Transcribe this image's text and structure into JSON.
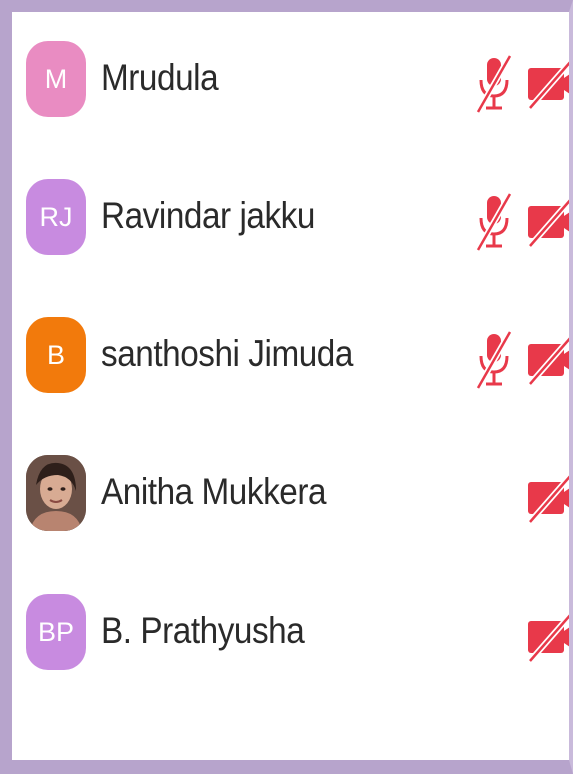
{
  "participants": [
    {
      "initials": "M",
      "name": "Mrudula",
      "avatar_color": "#e98cc2",
      "avatar_type": "initials",
      "mic": "muted-icon",
      "camera": "video-off-icon"
    },
    {
      "initials": "RJ",
      "name": "Ravindar jakku",
      "avatar_color": "#c88be0",
      "avatar_type": "initials",
      "mic": "muted-icon",
      "camera": "video-off-icon"
    },
    {
      "initials": "B",
      "name": "santhoshi Jimuda",
      "avatar_color": "#f27a0c",
      "avatar_type": "initials",
      "mic": "muted-icon",
      "camera": "video-off-icon"
    },
    {
      "initials": "",
      "name": "Anitha Mukkera",
      "avatar_color": "",
      "avatar_type": "photo",
      "mic": "",
      "camera": "video-off-icon"
    },
    {
      "initials": "BP",
      "name": "B. Prathyusha",
      "avatar_color": "#c88be0",
      "avatar_type": "initials",
      "mic": "",
      "camera": "video-off-icon"
    }
  ],
  "colors": {
    "frame": "#b7a4cc",
    "icon_red": "#e8394a",
    "text": "#2a2a2a"
  }
}
